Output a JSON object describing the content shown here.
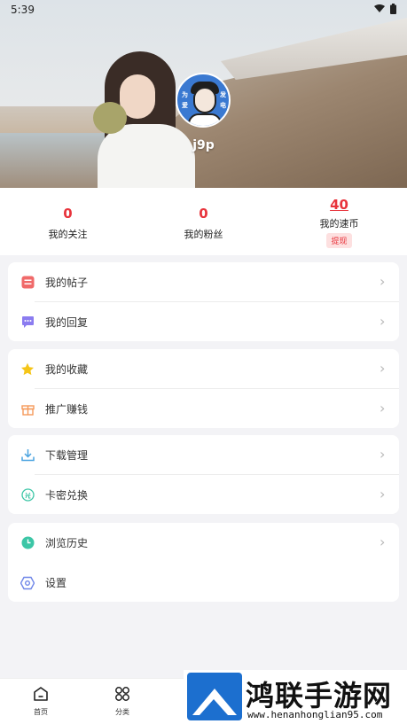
{
  "status_bar": {
    "time": "5:39"
  },
  "profile": {
    "username": "j9p",
    "avatar_tags": [
      "为",
      "爱",
      "发",
      "电"
    ]
  },
  "stats": [
    {
      "value": "0",
      "label": "我的关注"
    },
    {
      "value": "0",
      "label": "我的粉丝"
    },
    {
      "value": "40",
      "label": "我的速币",
      "action": "提现"
    }
  ],
  "menu_groups": [
    [
      {
        "label": "我的帖子",
        "icon": "post-icon",
        "color": "#f06a6a"
      },
      {
        "label": "我的回复",
        "icon": "reply-icon",
        "color": "#8b7cf0"
      }
    ],
    [
      {
        "label": "我的收藏",
        "icon": "star-icon",
        "color": "#f5c518"
      },
      {
        "label": "推广赚钱",
        "icon": "gift-icon",
        "color": "#f59a5a"
      }
    ],
    [
      {
        "label": "下载管理",
        "icon": "download-icon",
        "color": "#4aa3e0"
      },
      {
        "label": "卡密兑换",
        "icon": "redeem-icon",
        "color": "#3cc6a6"
      }
    ],
    [
      {
        "label": "浏览历史",
        "icon": "history-icon",
        "color": "#3cc6a6"
      },
      {
        "label": "设置",
        "icon": "settings-icon",
        "color": "#6f86e8"
      }
    ]
  ],
  "tabbar": [
    {
      "label": "首页",
      "icon": "home-icon"
    },
    {
      "label": "分类",
      "icon": "grid-icon"
    }
  ],
  "watermark": {
    "title": "鸿联手游网",
    "url": "www.henanhonglian95.com"
  }
}
